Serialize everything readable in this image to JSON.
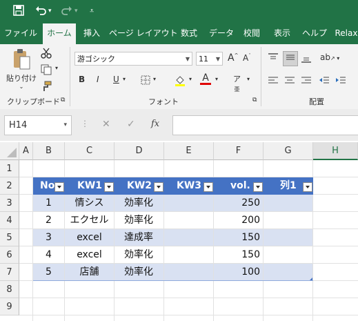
{
  "colors": {
    "brand": "#217346",
    "table_header": "#4472c4",
    "band": "#d9e1f2"
  },
  "qat": {
    "save": "save-icon",
    "undo": "undo-icon",
    "redo": "redo-icon",
    "customize": "customize-qat-icon"
  },
  "tabs": [
    "ファイル",
    "ホーム",
    "挿入",
    "ページ レイアウト",
    "数式",
    "データ",
    "校閲",
    "表示",
    "ヘルプ",
    "Relax"
  ],
  "active_tab": "ホーム",
  "ribbon": {
    "paste_label": "貼り付け",
    "clipboard_group": "クリップボード",
    "font_name": "游ゴシック",
    "font_size": "11",
    "font_group": "フォント",
    "align_group": "配置",
    "bold": "B",
    "italic": "I",
    "underline": "U"
  },
  "formula_bar": {
    "name_box": "H14",
    "fx": "fx",
    "value": ""
  },
  "columns": [
    "A",
    "B",
    "C",
    "D",
    "E",
    "F",
    "G",
    "H"
  ],
  "rows": [
    "1",
    "2",
    "3",
    "4",
    "5",
    "6",
    "7",
    "8",
    "9"
  ],
  "table": {
    "headers": [
      "No",
      "KW1",
      "KW2",
      "KW3",
      "vol.",
      "列1"
    ],
    "rows": [
      [
        "1",
        "情シス",
        "効率化",
        "",
        "250",
        ""
      ],
      [
        "2",
        "エクセル",
        "効率化",
        "",
        "200",
        ""
      ],
      [
        "3",
        "excel",
        "達成率",
        "",
        "150",
        ""
      ],
      [
        "4",
        "excel",
        "効率化",
        "",
        "150",
        ""
      ],
      [
        "5",
        "店舗",
        "効率化",
        "",
        "100",
        ""
      ]
    ]
  }
}
